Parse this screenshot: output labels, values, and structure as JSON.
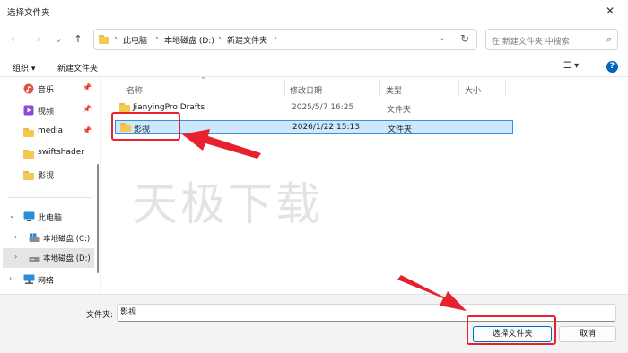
{
  "window": {
    "title": "选择文件夹",
    "close_glyph": "✕"
  },
  "nav": {
    "back": "←",
    "forward": "→",
    "recent": "⌄",
    "up": "↑"
  },
  "address": {
    "crumbs": [
      "此电脑",
      "本地磁盘 (D:)",
      "新建文件夹"
    ],
    "separator": "›",
    "dropdown_glyph": "⌄",
    "refresh_glyph": "↻"
  },
  "search": {
    "placeholder": "在 新建文件夹 中搜索",
    "icon": "search-icon",
    "glyph": "⌕"
  },
  "toolbar": {
    "organize": "组织 ▾",
    "new_folder": "新建文件夹",
    "view_glyph": "☰ ▾",
    "help_glyph": "?"
  },
  "sidebar": {
    "items": [
      {
        "label": "音乐",
        "icon": "music-icon",
        "pinned": true
      },
      {
        "label": "视频",
        "icon": "video-icon",
        "pinned": true
      },
      {
        "label": "media",
        "icon": "folder-icon",
        "pinned": true
      },
      {
        "label": "swiftshader",
        "icon": "folder-icon",
        "pinned": false
      },
      {
        "label": "影视",
        "icon": "folder-icon",
        "pinned": false
      },
      {
        "label": "此电脑",
        "icon": "computer-icon",
        "expanded": true
      },
      {
        "label": "本地磁盘 (C:)",
        "icon": "drive-icon"
      },
      {
        "label": "本地磁盘 (D:)",
        "icon": "drive-icon",
        "selected": true
      },
      {
        "label": "网络",
        "icon": "network-icon"
      }
    ],
    "pin_glyph": "📌",
    "expanded_glyph": "⌄",
    "collapsed_glyph": "›"
  },
  "columns": {
    "name": "名称",
    "modified": "修改日期",
    "type": "类型",
    "size": "大小",
    "sort_glyph": "⌃"
  },
  "files": [
    {
      "name": "JianyingPro Drafts",
      "modified": "2025/5/7 16:25",
      "type": "文件夹",
      "selected": false
    },
    {
      "name": "影视",
      "modified": "2026/1/22 15:13",
      "type": "文件夹",
      "selected": true
    }
  ],
  "watermark": "天极下载",
  "footer": {
    "filename_label": "文件夹:",
    "filename_value": "影视",
    "select_button": "选择文件夹",
    "cancel_button": "取消"
  },
  "annotations": {
    "highlight_color": "#e8212e"
  },
  "colors": {
    "accent": "#0067c0",
    "selection": "#cce8ff",
    "folder": "#f5c951"
  }
}
